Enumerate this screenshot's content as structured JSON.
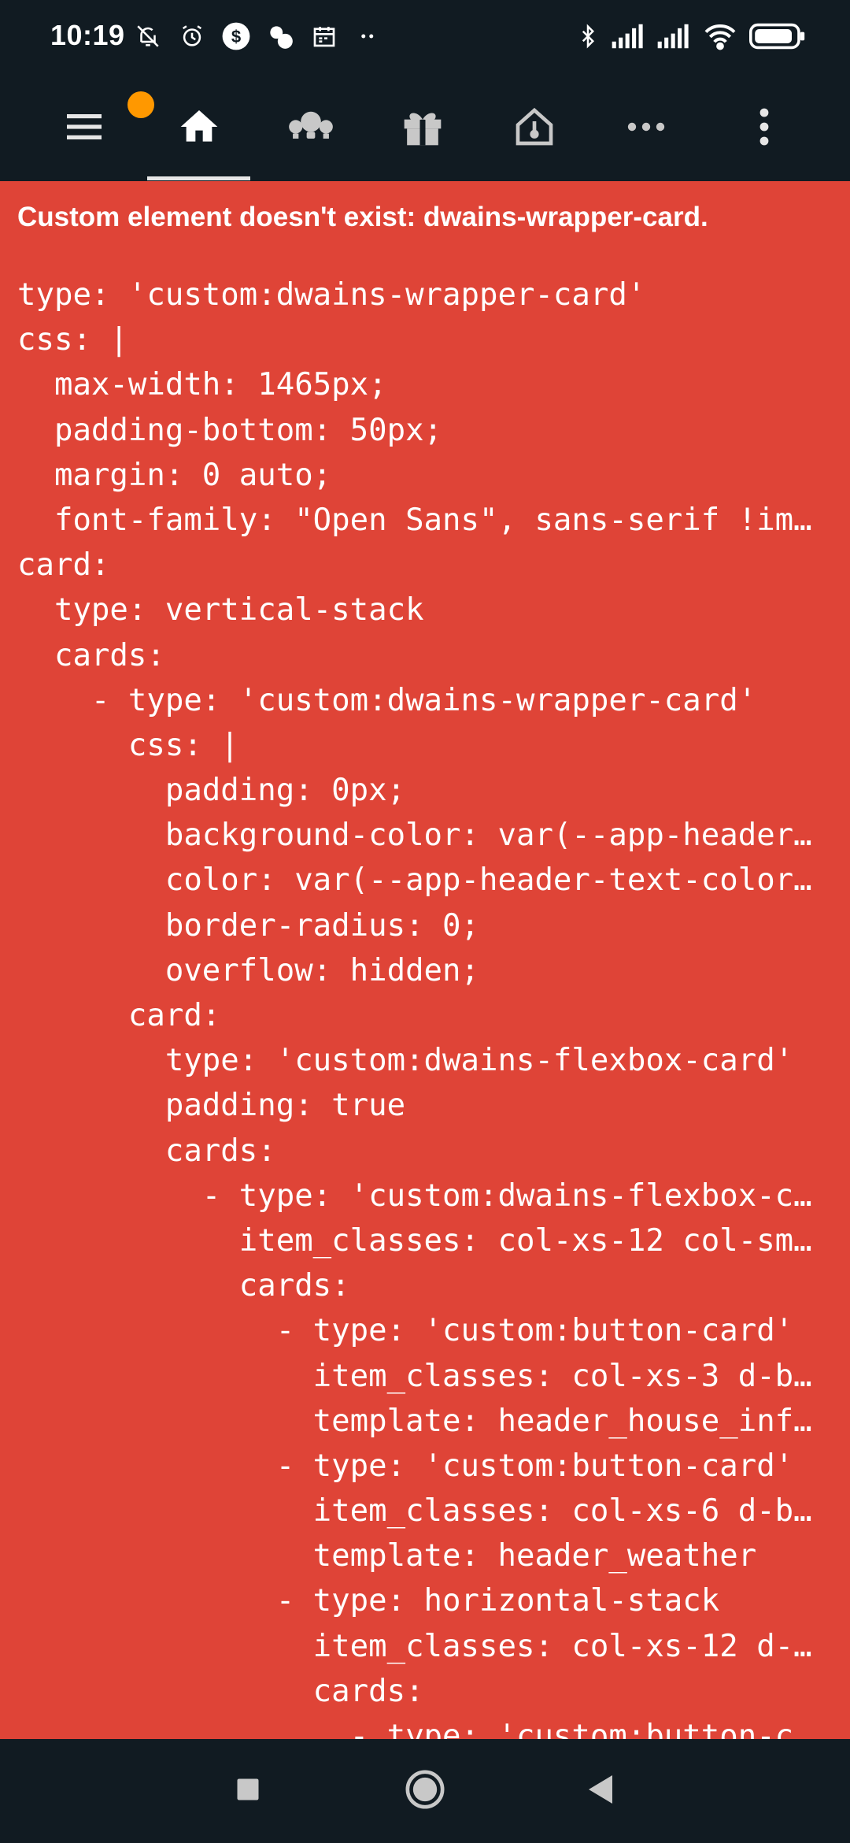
{
  "status_bar": {
    "time": "10:19",
    "left_icons": [
      "bell-off-icon",
      "alarm-icon",
      "dollar-app-icon",
      "weather-app-icon",
      "calendar-icon",
      "more-notifications-icon"
    ],
    "right_icons": [
      "bluetooth-icon",
      "signal-icon",
      "signal-icon",
      "wifi-icon",
      "battery-icon"
    ]
  },
  "toolbar": {
    "items": [
      {
        "name": "menu",
        "icon": "menu-icon",
        "has_badge": true,
        "badge_color": "#ff9800"
      },
      {
        "name": "home",
        "icon": "home-icon",
        "active": true
      },
      {
        "name": "lights",
        "icon": "lightbulb-group-icon"
      },
      {
        "name": "gift",
        "icon": "gift-icon"
      },
      {
        "name": "house-gauge",
        "icon": "home-gauge-icon"
      },
      {
        "name": "more-views",
        "icon": "dots-horizontal-icon"
      },
      {
        "name": "overflow",
        "icon": "dots-vertical-icon"
      }
    ]
  },
  "error_card": {
    "background": "#df4437",
    "title": "Custom element doesn't exist: dwains-wrapper-card.",
    "code_lines": [
      "type: 'custom:dwains-wrapper-card'",
      "css: |",
      "  max-width: 1465px;",
      "  padding-bottom: 50px;",
      "  margin: 0 auto;",
      "  font-family: \"Open Sans\", sans-serif !im…",
      "card:",
      "  type: vertical-stack",
      "  cards:",
      "    - type: 'custom:dwains-wrapper-card'",
      "      css: |",
      "        padding: 0px;",
      "        background-color: var(--app-header…",
      "        color: var(--app-header-text-color…",
      "        border-radius: 0;",
      "        overflow: hidden;",
      "      card:",
      "        type: 'custom:dwains-flexbox-card'",
      "        padding: true",
      "        cards:",
      "          - type: 'custom:dwains-flexbox-c…",
      "            item_classes: col-xs-12 col-sm…",
      "            cards:",
      "              - type: 'custom:button-card'",
      "                item_classes: col-xs-3 d-b…",
      "                template: header_house_inf…",
      "              - type: 'custom:button-card'",
      "                item_classes: col-xs-6 d-b…",
      "                template: header_weather",
      "              - type: horizontal-stack",
      "                item_classes: col-xs-12 d-…",
      "                cards:",
      "                  - type: 'custom:button-c…"
    ]
  },
  "nav_bar": {
    "buttons": [
      "recent-apps-icon",
      "home-circle-icon",
      "back-triangle-icon"
    ]
  }
}
